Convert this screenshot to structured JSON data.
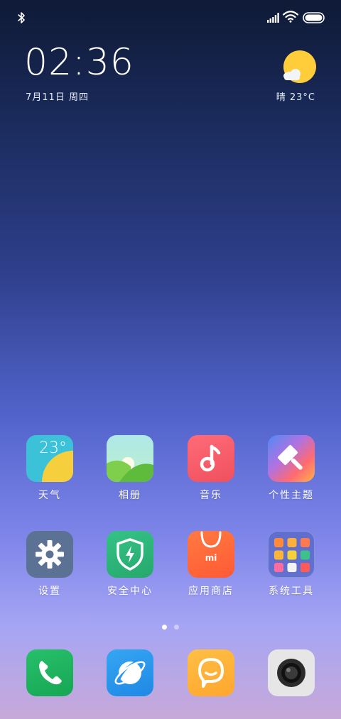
{
  "status_bar": {
    "bluetooth": "bluetooth-icon",
    "signal": "signal-icon",
    "wifi": "wifi-icon",
    "battery": "battery-icon"
  },
  "clock": {
    "time": "02:36",
    "date": "7月11日 周四"
  },
  "weather": {
    "icon": "sun-icon",
    "text": "晴  23°C"
  },
  "apps": [
    {
      "label": "天气",
      "icon": "weather-icon",
      "value": "23°"
    },
    {
      "label": "相册",
      "icon": "gallery-icon"
    },
    {
      "label": "音乐",
      "icon": "music-icon"
    },
    {
      "label": "个性主题",
      "icon": "themes-icon"
    },
    {
      "label": "设置",
      "icon": "settings-icon"
    },
    {
      "label": "安全中心",
      "icon": "security-icon"
    },
    {
      "label": "应用商店",
      "icon": "app-store-icon",
      "brand": "mi"
    },
    {
      "label": "系统工具",
      "icon": "folder-icon"
    }
  ],
  "pages": {
    "count": 2,
    "active": 1
  },
  "dock": [
    {
      "icon": "phone-icon"
    },
    {
      "icon": "browser-icon"
    },
    {
      "icon": "messages-icon"
    },
    {
      "icon": "camera-icon"
    }
  ],
  "colors": {
    "weather": "#3cc2d8",
    "gallery": "#8fd35a",
    "music": "#f45b6a",
    "settings": "#5c7294",
    "security": "#2fb67a",
    "store": "#ff6a3a",
    "folder": "#5b6bc8",
    "phone": "#1fb35e",
    "browser": "#2a96ee",
    "messages": "#ffb339",
    "camera": "#e3e3e3"
  }
}
